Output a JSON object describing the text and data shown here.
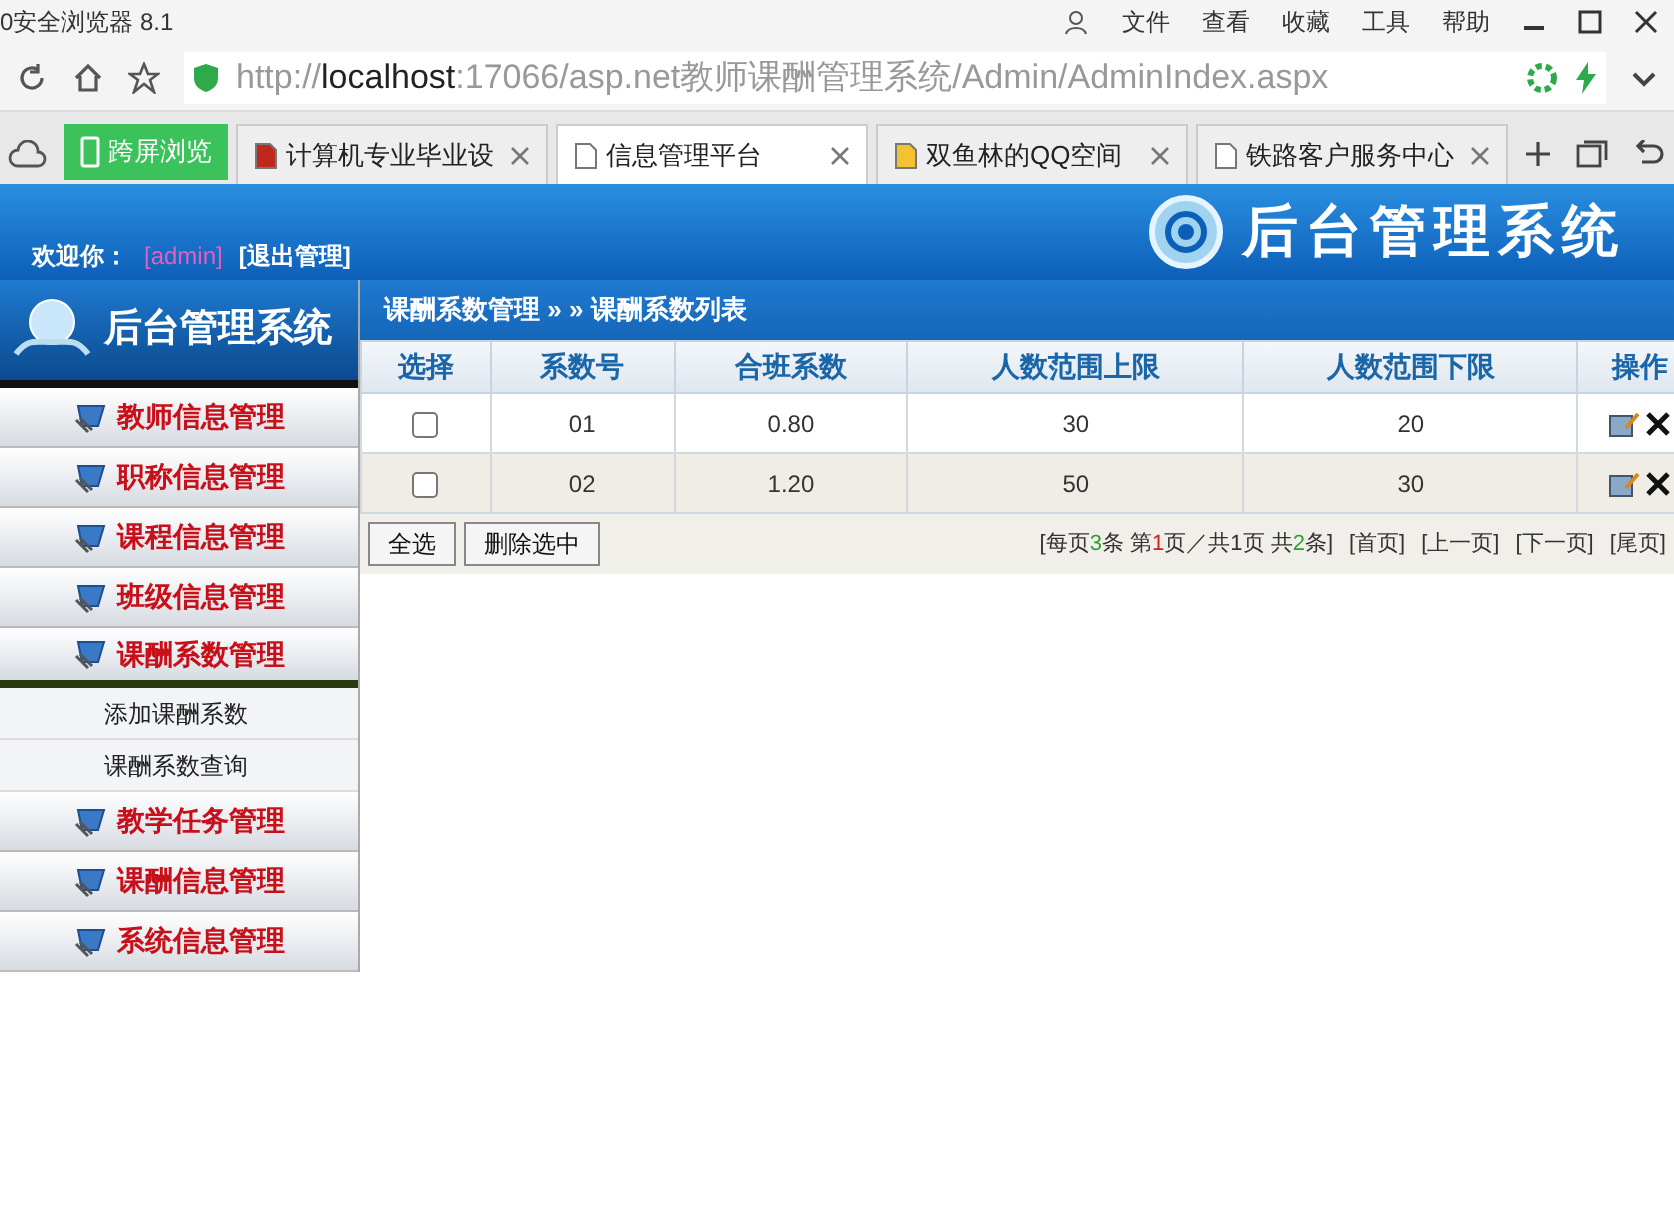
{
  "window": {
    "title": "0安全浏览器 8.1",
    "menu": [
      "文件",
      "查看",
      "收藏",
      "工具",
      "帮助"
    ]
  },
  "address_bar": {
    "scheme": "http://",
    "host": "localhost",
    "path": ":17066/asp.net教师课酬管理系统/Admin/AdminIndex.aspx"
  },
  "tabs": [
    {
      "label": "跨屏浏览",
      "kind": "button",
      "selected": false
    },
    {
      "label": "计算机专业毕业设",
      "kind": "tab",
      "selected": false
    },
    {
      "label": "信息管理平台",
      "kind": "tab",
      "selected": true
    },
    {
      "label": "双鱼林的QQ空间",
      "kind": "tab",
      "selected": false
    },
    {
      "label": "铁路客户服务中心",
      "kind": "tab",
      "selected": false
    }
  ],
  "header": {
    "welcome": "欢迎你：",
    "user": "[admin]",
    "logout": "[退出管理]",
    "logo": "后台管理系统"
  },
  "sidebar": {
    "title": "后台管理系统",
    "items": [
      {
        "label": "教师信息管理",
        "expanded": false
      },
      {
        "label": "职称信息管理",
        "expanded": false
      },
      {
        "label": "课程信息管理",
        "expanded": false
      },
      {
        "label": "班级信息管理",
        "expanded": false
      },
      {
        "label": "课酬系数管理",
        "expanded": true,
        "children": [
          {
            "label": "添加课酬系数"
          },
          {
            "label": "课酬系数查询"
          }
        ]
      },
      {
        "label": "教学任务管理",
        "expanded": false
      },
      {
        "label": "课酬信息管理",
        "expanded": false
      },
      {
        "label": "系统信息管理",
        "expanded": false
      }
    ]
  },
  "breadcrumb": "课酬系数管理 » » 课酬系数列表",
  "table": {
    "columns": [
      "选择",
      "系数号",
      "合班系数",
      "人数范围上限",
      "人数范围下限",
      "操作"
    ],
    "rows": [
      {
        "cells": [
          {
            "kind": "checkbox",
            "checked": false
          },
          {
            "kind": "text",
            "text": "01"
          },
          {
            "kind": "text",
            "text": "0.80"
          },
          {
            "kind": "text",
            "text": "30"
          },
          {
            "kind": "text",
            "text": "20"
          },
          {
            "kind": "actions"
          }
        ]
      },
      {
        "cells": [
          {
            "kind": "checkbox",
            "checked": false
          },
          {
            "kind": "text",
            "text": "02"
          },
          {
            "kind": "text",
            "text": "1.20"
          },
          {
            "kind": "text",
            "text": "50"
          },
          {
            "kind": "text",
            "text": "30"
          },
          {
            "kind": "actions"
          }
        ]
      }
    ]
  },
  "buttons": [
    "全选",
    "删除选中"
  ],
  "pager": {
    "summary": [
      {
        "text": "[每页",
        "color": "#333333"
      },
      {
        "text": "3",
        "color": "#2e9e2e"
      },
      {
        "text": "条 第",
        "color": "#333333"
      },
      {
        "text": "1",
        "color": "#d02020"
      },
      {
        "text": "页／共",
        "color": "#333333"
      },
      {
        "text": "1",
        "color": "#333333"
      },
      {
        "text": "页 共",
        "color": "#333333"
      },
      {
        "text": "2",
        "color": "#2e9e2e"
      },
      {
        "text": "条]",
        "color": "#333333"
      }
    ],
    "links": [
      "[首页]",
      "[上一页]",
      "[下一页]",
      "[尾页]"
    ]
  }
}
